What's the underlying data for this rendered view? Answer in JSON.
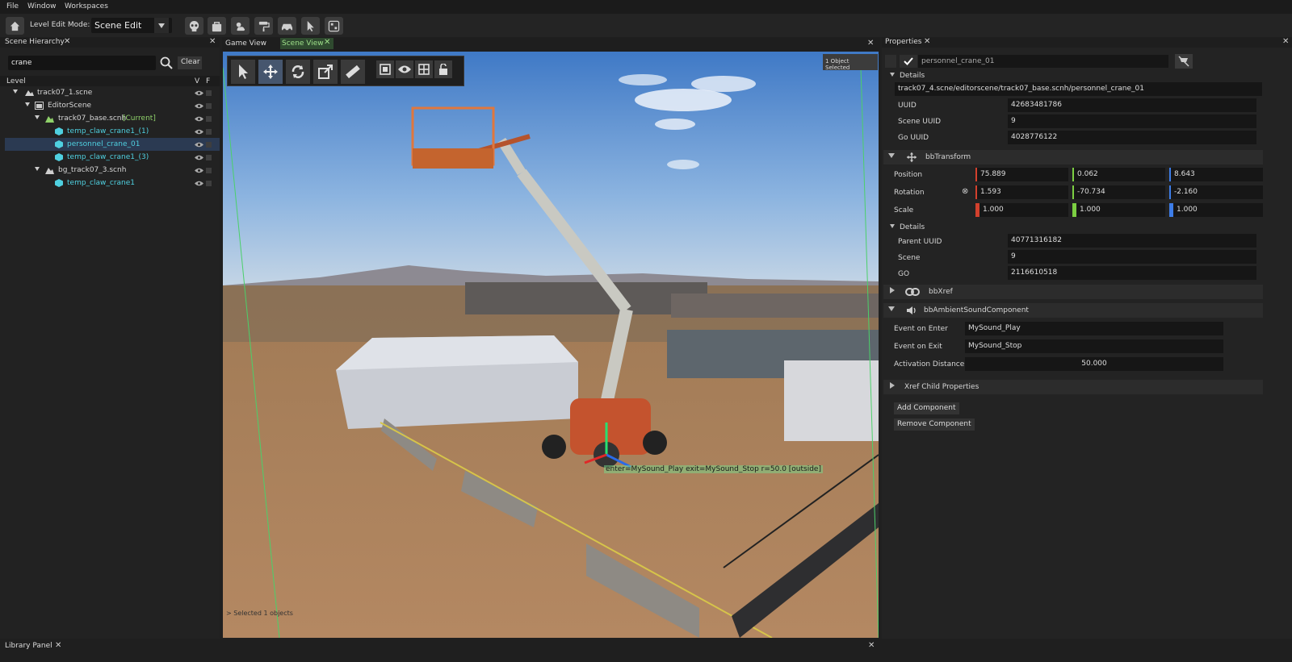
{
  "menu": [
    "File",
    "Window",
    "Workspaces"
  ],
  "toolbar": {
    "mode_label": "Level Edit Mode:",
    "mode_value": "Scene Edit",
    "icons": [
      "home-icon",
      "skull-icon",
      "bag-icon",
      "weather-icon",
      "paint-roller-icon",
      "car-icon",
      "cursor-icon",
      "layout-icon"
    ]
  },
  "hierarchy": {
    "tab": "Scene Hierarchy",
    "search_value": "crane",
    "clear": "Clear",
    "col_level": "Level",
    "col_v": "V",
    "col_f": "F",
    "rows": [
      {
        "label": "track07_1.scne"
      },
      {
        "label": "EditorScene"
      },
      {
        "label": "track07_base.scnh",
        "tag": "[Current]"
      },
      {
        "label": "temp_claw_crane1_(1)"
      },
      {
        "label": "personnel_crane_01"
      },
      {
        "label": "temp_claw_crane1_(3)"
      },
      {
        "label": "bg_track07_3.scnh"
      },
      {
        "label": "temp_claw_crane1"
      }
    ]
  },
  "viewport": {
    "tab_game": "Game View",
    "tab_scene": "Scene View",
    "selected_badge": "1 Object Selected",
    "sound_label": "enter=MySound_Play exit=MySound_Stop r=50.0 [outside]",
    "status": "> Selected 1 objects"
  },
  "properties": {
    "tab": "Properties",
    "name": "personnel_crane_01",
    "details_title": "Details",
    "path": "track07_4.scne/editorscene/track07_base.scnh/personnel_crane_01",
    "uuid_label": "UUID",
    "uuid": "42683481786",
    "scene_uuid_label": "Scene UUID",
    "scene_uuid": "9",
    "go_uuid_label": "Go UUID",
    "go_uuid": "4028776122",
    "transform_title": "bbTransform",
    "position_label": "Position",
    "position": [
      "75.889",
      "0.062",
      "8.643"
    ],
    "rotation_label": "Rotation",
    "rotation": [
      "1.593",
      "-70.734",
      "-2.160"
    ],
    "scale_label": "Scale",
    "scale": [
      "1.000",
      "1.000",
      "1.000"
    ],
    "details2_title": "Details",
    "parent_uuid_label": "Parent UUID",
    "parent_uuid": "40771316182",
    "scene_label": "Scene",
    "scene": "9",
    "go_label": "GO",
    "go": "2116610518",
    "xref_title": "bbXref",
    "ambient_title": "bbAmbientSoundComponent",
    "event_enter_label": "Event on Enter",
    "event_enter": "MySound_Play",
    "event_exit_label": "Event on Exit",
    "event_exit": "MySound_Stop",
    "activation_label": "Activation Distance",
    "activation": "50.000",
    "xref_child_title": "Xref Child Properties",
    "add_component": "Add Component",
    "remove_component": "Remove Component"
  },
  "library": {
    "tab": "Library Panel"
  },
  "colors": {
    "accent_green": "#8fd16a",
    "selection": "#2b3a52",
    "cyan_item": "#4fd0e0"
  }
}
